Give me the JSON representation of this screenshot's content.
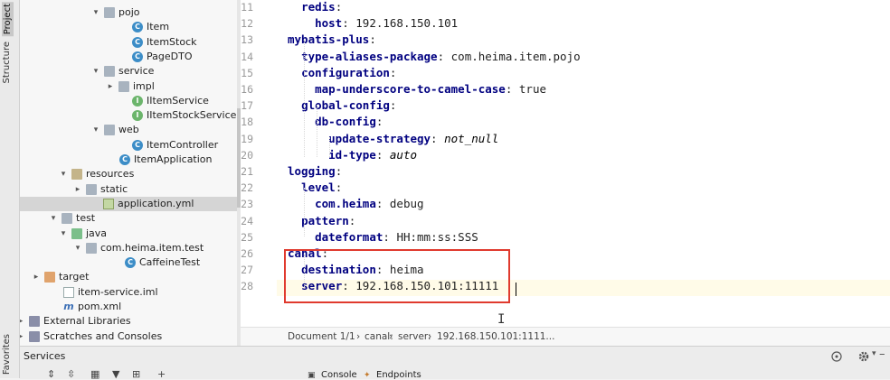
{
  "window": {
    "side_tabs": {
      "project": "Project",
      "structure": "Structure",
      "favorites": "Favorites"
    }
  },
  "project_tree": {
    "rows": [
      {
        "label": "pojo",
        "kind": "folder",
        "arrow": "▾"
      },
      {
        "label": "Item",
        "kind": "class",
        "arrow": ""
      },
      {
        "label": "ItemStock",
        "kind": "class",
        "arrow": ""
      },
      {
        "label": "PageDTO",
        "kind": "class",
        "arrow": ""
      },
      {
        "label": "service",
        "kind": "folder",
        "arrow": "▾"
      },
      {
        "label": "impl",
        "kind": "folder",
        "arrow": "▸"
      },
      {
        "label": "IItemService",
        "kind": "interface",
        "arrow": ""
      },
      {
        "label": "IItemStockService",
        "kind": "interface",
        "arrow": ""
      },
      {
        "label": "web",
        "kind": "folder",
        "arrow": "▾"
      },
      {
        "label": "ItemController",
        "kind": "class",
        "arrow": ""
      },
      {
        "label": "ItemApplication",
        "kind": "class",
        "arrow": ""
      },
      {
        "label": "resources",
        "kind": "folder-res",
        "arrow": "▾"
      },
      {
        "label": "static",
        "kind": "folder",
        "arrow": "▸"
      },
      {
        "label": "application.yml",
        "kind": "yml",
        "arrow": ""
      },
      {
        "label": "test",
        "kind": "folder",
        "arrow": "▾"
      },
      {
        "label": "java",
        "kind": "folder-test",
        "arrow": "▾"
      },
      {
        "label": "com.heima.item.test",
        "kind": "folder",
        "arrow": "▾"
      },
      {
        "label": "CaffeineTest",
        "kind": "class",
        "arrow": ""
      },
      {
        "label": "target",
        "kind": "folder-target",
        "arrow": "▸"
      },
      {
        "label": "item-service.iml",
        "kind": "file",
        "arrow": ""
      },
      {
        "label": "pom.xml",
        "kind": "maven",
        "arrow": ""
      },
      {
        "label": "External Libraries",
        "kind": "lib",
        "arrow": "▸"
      },
      {
        "label": "Scratches and Consoles",
        "kind": "scratch",
        "arrow": "▸"
      }
    ]
  },
  "editor": {
    "lines": [
      {
        "num": "11",
        "indent": "  ",
        "key": "redis",
        "sep": ":",
        "value": "",
        "italic": false
      },
      {
        "num": "12",
        "indent": "    ",
        "key": "host",
        "sep": ": ",
        "value": "192.168.150.101",
        "italic": false
      },
      {
        "num": "13",
        "indent": "",
        "key": "mybatis-plus",
        "sep": ":",
        "value": "",
        "italic": false
      },
      {
        "num": "14",
        "indent": "  ",
        "key": "type-aliases-package",
        "sep": ": ",
        "value": "com.heima.item.pojo",
        "italic": false
      },
      {
        "num": "15",
        "indent": "  ",
        "key": "configuration",
        "sep": ":",
        "value": "",
        "italic": false
      },
      {
        "num": "16",
        "indent": "    ",
        "key": "map-underscore-to-camel-case",
        "sep": ": ",
        "value": "true",
        "italic": false
      },
      {
        "num": "17",
        "indent": "  ",
        "key": "global-config",
        "sep": ":",
        "value": "",
        "italic": false
      },
      {
        "num": "18",
        "indent": "    ",
        "key": "db-config",
        "sep": ":",
        "value": "",
        "italic": false
      },
      {
        "num": "19",
        "indent": "      ",
        "key": "update-strategy",
        "sep": ": ",
        "value": "not_null",
        "italic": true
      },
      {
        "num": "20",
        "indent": "      ",
        "key": "id-type",
        "sep": ": ",
        "value": "auto",
        "italic": true
      },
      {
        "num": "21",
        "indent": "",
        "key": "logging",
        "sep": ":",
        "value": "",
        "italic": false
      },
      {
        "num": "22",
        "indent": "  ",
        "key": "level",
        "sep": ":",
        "value": "",
        "italic": false
      },
      {
        "num": "23",
        "indent": "    ",
        "key": "com.heima",
        "sep": ": ",
        "value": "debug",
        "italic": false
      },
      {
        "num": "24",
        "indent": "  ",
        "key": "pattern",
        "sep": ":",
        "value": "",
        "italic": false
      },
      {
        "num": "25",
        "indent": "    ",
        "key": "dateformat",
        "sep": ": ",
        "value": "HH:mm:ss:SSS",
        "italic": false
      },
      {
        "num": "26",
        "indent": "",
        "key": "canal",
        "sep": ":",
        "value": "",
        "italic": false
      },
      {
        "num": "27",
        "indent": "  ",
        "key": "destination",
        "sep": ": ",
        "value": "heima",
        "italic": false
      },
      {
        "num": "28",
        "indent": "  ",
        "key": "server",
        "sep": ": ",
        "value": "192.168.150.101:11111",
        "italic": false
      }
    ],
    "current_line": "28",
    "highlight_color": "#e03a2e"
  },
  "breadcrumb": {
    "items": [
      "Document 1/1",
      "canal:",
      "server:",
      "192.168.150.101:1111..."
    ]
  },
  "services": {
    "title": "Services",
    "tabs": {
      "console": "Console",
      "endpoints": "Endpoints"
    }
  },
  "icons": {
    "settings": "gear-icon",
    "target": "crosshair-icon",
    "minimize": "minimize-icon"
  }
}
